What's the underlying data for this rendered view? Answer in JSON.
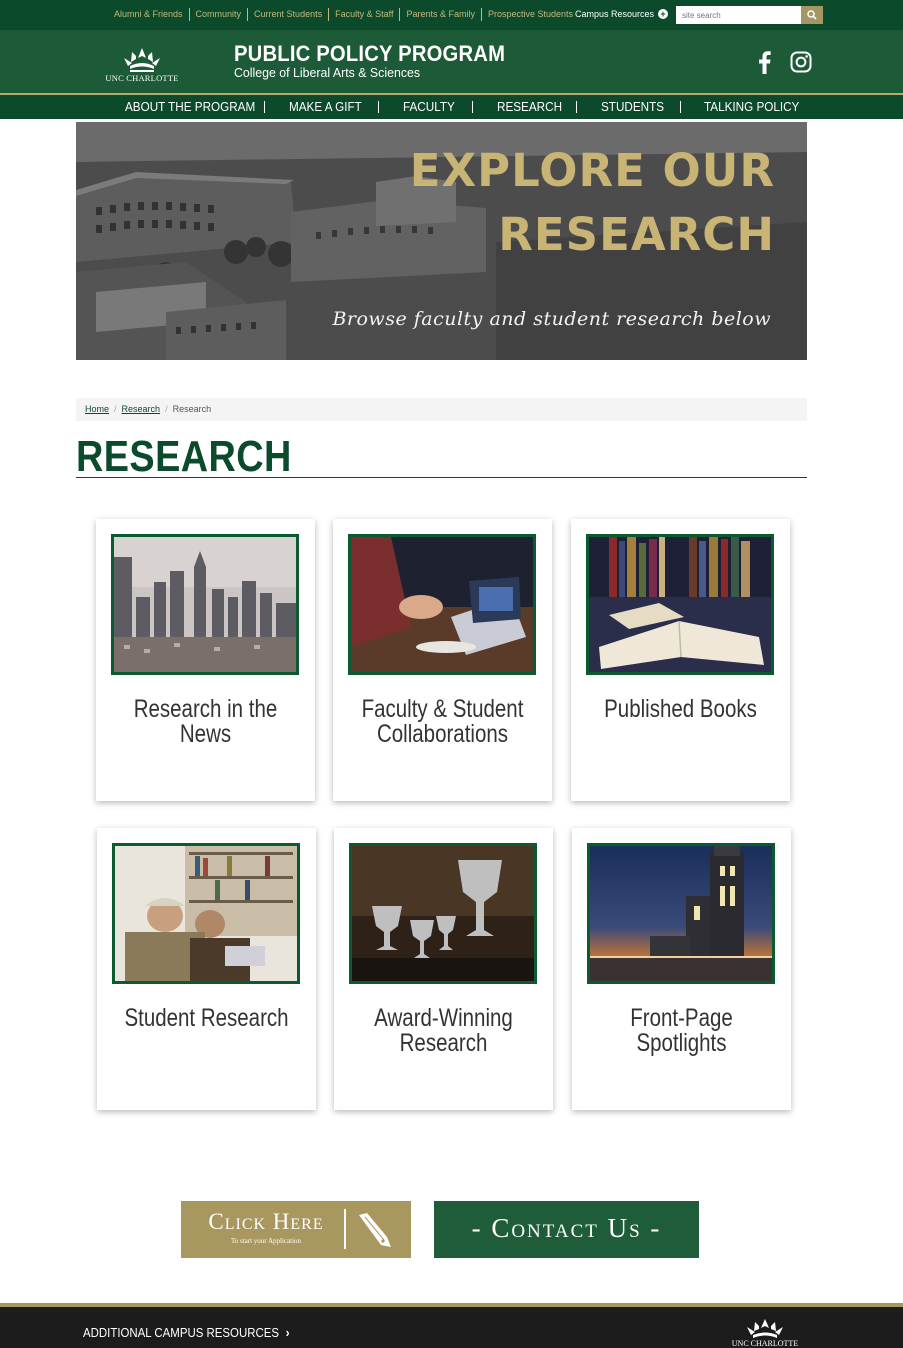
{
  "utility_bar": {
    "links": [
      "Alumni & Friends",
      "Community",
      "Current Students",
      "Faculty & Staff",
      "Parents & Family",
      "Prospective Students"
    ],
    "campus_resources": "Campus Resources",
    "search_placeholder": "site search",
    "icons": {
      "search": "search-icon",
      "plus": "plus-circle-icon"
    }
  },
  "header": {
    "logo_text": "UNC CHARLOTTE",
    "title": "PUBLIC POLICY PROGRAM",
    "subtitle": "College of Liberal Arts & Sciences",
    "social_icons": [
      "facebook-icon",
      "instagram-icon"
    ]
  },
  "nav": {
    "items": [
      "ABOUT THE PROGRAM",
      "MAKE A GIFT",
      "FACULTY",
      "RESEARCH",
      "STUDENTS",
      "TALKING POLICY"
    ]
  },
  "banner": {
    "headline_line1": "EXPLORE OUR",
    "headline_line2": "RESEARCH",
    "subtext": "Browse faculty and student research below"
  },
  "breadcrumb": {
    "items": [
      "Home",
      "Research",
      "Research"
    ]
  },
  "page": {
    "title": "RESEARCH"
  },
  "cards": [
    {
      "title_line1": "Research in the News",
      "title_line2": ""
    },
    {
      "title_line1": "Faculty & Student",
      "title_line2": "Collaborations"
    },
    {
      "title_line1": "Published Books",
      "title_line2": ""
    },
    {
      "title_line1": "Student Research",
      "title_line2": ""
    },
    {
      "title_line1": "Award-Winning",
      "title_line2": "Research"
    },
    {
      "title_line1": "Front-Page Spotlights",
      "title_line2": ""
    }
  ],
  "cta": {
    "apply_label": "Click Here",
    "apply_small": "To start your Application",
    "contact_label": "- Contact Us -"
  },
  "footer": {
    "link": "ADDITIONAL CAMPUS RESOURCES",
    "logo_text": "UNC CHARLOTTE"
  },
  "colors": {
    "brand_green": "#0b4a2a",
    "header_green": "#1d5a37",
    "gold": "#a8985f",
    "banner_gold": "#c8b474"
  }
}
